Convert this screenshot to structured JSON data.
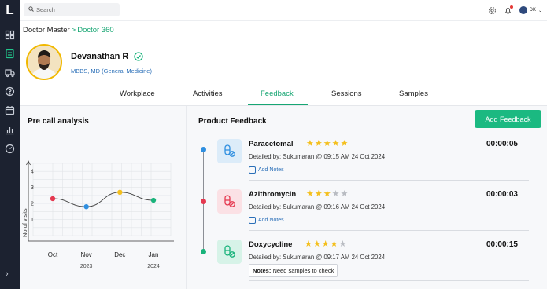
{
  "app": {
    "logo_letter": "L"
  },
  "search": {
    "placeholder": "Search"
  },
  "user": {
    "initials": "DK"
  },
  "breadcrumb": {
    "root": "Doctor Master",
    "separator": ">",
    "current": "Doctor 360"
  },
  "profile": {
    "name": "Devanathan R",
    "degree": "MBBS, MD (General Medicine)"
  },
  "tabs": [
    {
      "label": "Workplace"
    },
    {
      "label": "Activities"
    },
    {
      "label": "Feedback"
    },
    {
      "label": "Sessions"
    },
    {
      "label": "Samples"
    }
  ],
  "active_tab": "Feedback",
  "pre_call": {
    "title": "Pre call analysis"
  },
  "chart_data": {
    "type": "line",
    "title": "Pre call analysis",
    "xlabel": "",
    "ylabel": "No of visits",
    "categories": [
      "Oct",
      "Nov",
      "Dec",
      "Jan"
    ],
    "year_labels": [
      "2023",
      "2024"
    ],
    "y_ticks": [
      "1",
      "2",
      "3",
      "4"
    ],
    "ylim": [
      0,
      4.5
    ],
    "values": [
      2.3,
      1.8,
      2.7,
      2.2
    ],
    "point_colors": [
      "#e53950",
      "#2f8fe0",
      "#f4bf1c",
      "#19b37b"
    ],
    "grid": true
  },
  "product_feedback": {
    "title": "Product Feedback",
    "add_button": "Add Feedback",
    "items": [
      {
        "drug": "Paracetomal",
        "rating": 5,
        "max_rating": 5,
        "duration": "00:00:05",
        "detail": "Detailed by: Sukumaran @ 09:15 AM 24 Oct 2024",
        "action": "Add Notes",
        "dot_color": "#2f8fe0",
        "pill_bg": "#dcecf9",
        "pill_color": "#2f8fe0"
      },
      {
        "drug": "Azithromycin",
        "rating": 3,
        "max_rating": 5,
        "duration": "00:00:03",
        "detail": "Detailed by: Sukumaran @ 09:16 AM 24 Oct 2024",
        "action": "Add Notes",
        "dot_color": "#e53950",
        "pill_bg": "#fbe1e5",
        "pill_color": "#e53950"
      },
      {
        "drug": "Doxycycline",
        "rating": 4,
        "max_rating": 5,
        "duration": "00:00:15",
        "detail": "Detailed by: Sukumaran @ 09:17 AM 24 Oct 2024",
        "notes_label": "Notes:",
        "notes_text": "Need samples to check",
        "dot_color": "#19b37b",
        "pill_bg": "#d7f3e8",
        "pill_color": "#19b37b"
      }
    ]
  },
  "colors": {
    "accent": "#1bb981",
    "rail": "#1c2230",
    "star": "#f4bf1c",
    "star_empty": "#b9bcc2"
  }
}
